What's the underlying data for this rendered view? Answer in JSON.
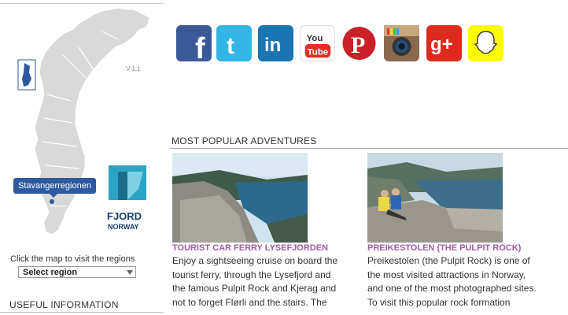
{
  "map": {
    "version": "V 1.1",
    "region_tooltip": "Stavangerregionen",
    "logo_line1": "FJORD",
    "logo_line2": "NORWAY",
    "click_hint": "Click the map to visit the regions",
    "select_value": "Select region"
  },
  "useful_info": {
    "title": "USEFUL INFORMATION"
  },
  "social": [
    {
      "name": "facebook",
      "glyph": "f",
      "color": "#3b5998"
    },
    {
      "name": "twitter",
      "glyph": "t",
      "color": "#33b5e5"
    },
    {
      "name": "linkedin",
      "glyph": "in",
      "color": "#1a75b2"
    },
    {
      "name": "youtube",
      "glyph": "You Tube",
      "color": "#e52d27"
    },
    {
      "name": "pinterest",
      "glyph": "P",
      "color": "#cb2027"
    },
    {
      "name": "instagram",
      "glyph": "camera",
      "color": "#8a6a4f"
    },
    {
      "name": "google-plus",
      "glyph": "g+",
      "color": "#dd2a1c"
    },
    {
      "name": "snapchat",
      "glyph": "ghost",
      "color": "#fffc00"
    }
  ],
  "adventures": {
    "title": "MOST POPULAR ADVENTURES",
    "cards": [
      {
        "title": "TOURIST CAR FERRY LYSEFJORDEN",
        "text": "Enjoy a sightseeing cruise on board the tourist ferry, through the Lysefjord and the famous Pulpit Rock and Kjerag and not to forget Flørli and the stairs. The"
      },
      {
        "title": "PREIKESTOLEN (THE PULPIT ROCK)",
        "text": "Preikestolen (the Pulpit Rock) is one of the most visited attractions in Norway, and one of the most photographed sites. To visit this popular rock formation"
      }
    ]
  }
}
